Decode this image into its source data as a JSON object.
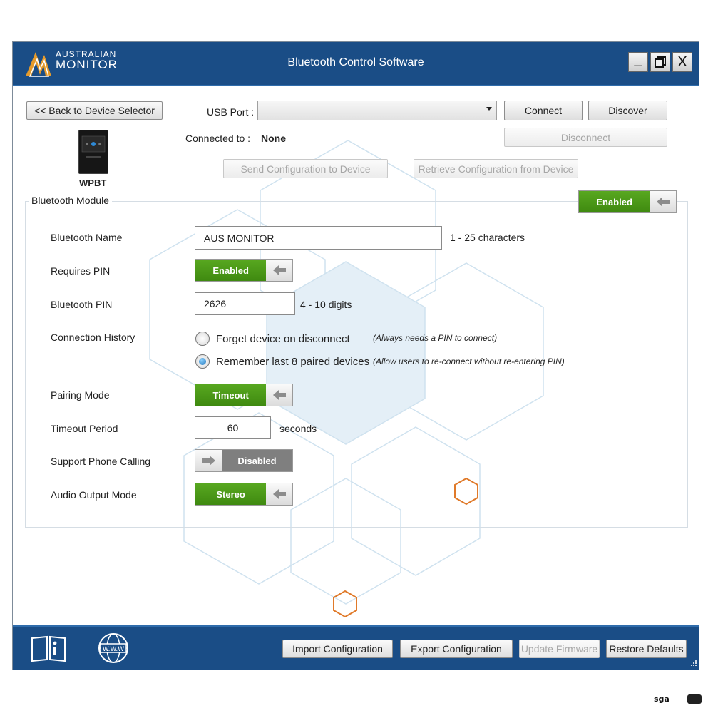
{
  "window": {
    "title": "Bluetooth Control Software",
    "logo": {
      "line1": "AUSTRALIAN",
      "line2": "MONITOR"
    },
    "controls": {
      "minimize": "_",
      "close": "X"
    }
  },
  "top": {
    "back_button": "<<  Back to Device Selector",
    "usb_port_label": "USB Port :",
    "usb_port_value": "",
    "connect_button": "Connect",
    "discover_button": "Discover",
    "disconnect_button": "Disconnect",
    "connected_to_label": "Connected to :",
    "connected_to_value": "None",
    "device_name": "WPBT",
    "send_config_button": "Send Configuration to Device",
    "retrieve_config_button": "Retrieve Configuration from Device"
  },
  "module": {
    "title": "Bluetooth Module",
    "enabled_toggle": "Enabled",
    "rows": {
      "name_label": "Bluetooth Name",
      "name_value": "AUS MONITOR",
      "name_hint": "1 - 25 characters",
      "requires_pin_label": "Requires PIN",
      "requires_pin_toggle": "Enabled",
      "pin_label": "Bluetooth PIN",
      "pin_value": "2626",
      "pin_hint": "4 - 10 digits",
      "history_label": "Connection History",
      "history_option1": "Forget device on disconnect",
      "history_option1_hint": "(Always needs a PIN to connect)",
      "history_option2": "Remember last 8 paired devices",
      "history_option2_hint": "(Allow users to re-connect without re-entering PIN)",
      "pairing_label": "Pairing Mode",
      "pairing_toggle": "Timeout",
      "timeout_label": "Timeout Period",
      "timeout_value": "60",
      "timeout_unit": "seconds",
      "phone_label": "Support Phone Calling",
      "phone_toggle": "Disabled",
      "audio_label": "Audio Output Mode",
      "audio_toggle": "Stereo"
    }
  },
  "bottom": {
    "import_button": "Import Configuration",
    "export_button": "Export Configuration",
    "update_button": "Update Firmware",
    "restore_button": "Restore Defaults",
    "www_icon_text": "W.W.W"
  },
  "watermark": "sga",
  "colors": {
    "titlebar": "#1a4d86",
    "toggle_on": "#4a9a18",
    "toggle_off": "#7f7f7f",
    "hex_accent": "#e07a2a"
  }
}
